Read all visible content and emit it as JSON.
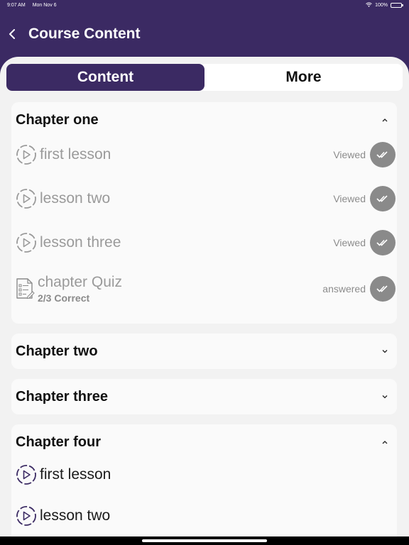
{
  "status_bar": {
    "time": "9:07 AM",
    "date": "Mon Nov 6",
    "battery": "100%"
  },
  "nav": {
    "title": "Course Content"
  },
  "tabs": [
    {
      "label": "Content",
      "active": true
    },
    {
      "label": "More",
      "active": false
    }
  ],
  "chapters": [
    {
      "title": "Chapter one",
      "expanded": true,
      "items": [
        {
          "label": "first lesson",
          "status": "Viewed"
        },
        {
          "label": "lesson two",
          "status": "Viewed"
        },
        {
          "label": "lesson three",
          "status": "Viewed"
        },
        {
          "label": "chapter Quiz",
          "sub": "2/3 Correct",
          "status": "answered"
        }
      ]
    },
    {
      "title": "Chapter two",
      "expanded": false
    },
    {
      "title": "Chapter three",
      "expanded": false
    },
    {
      "title": "Chapter four",
      "expanded": true,
      "items": [
        {
          "label": "first lesson"
        },
        {
          "label": "lesson two"
        }
      ]
    }
  ],
  "colors": {
    "primary": "#3b2a63",
    "badge": "#8a8a8a",
    "muted_text": "#9a9a9a"
  }
}
